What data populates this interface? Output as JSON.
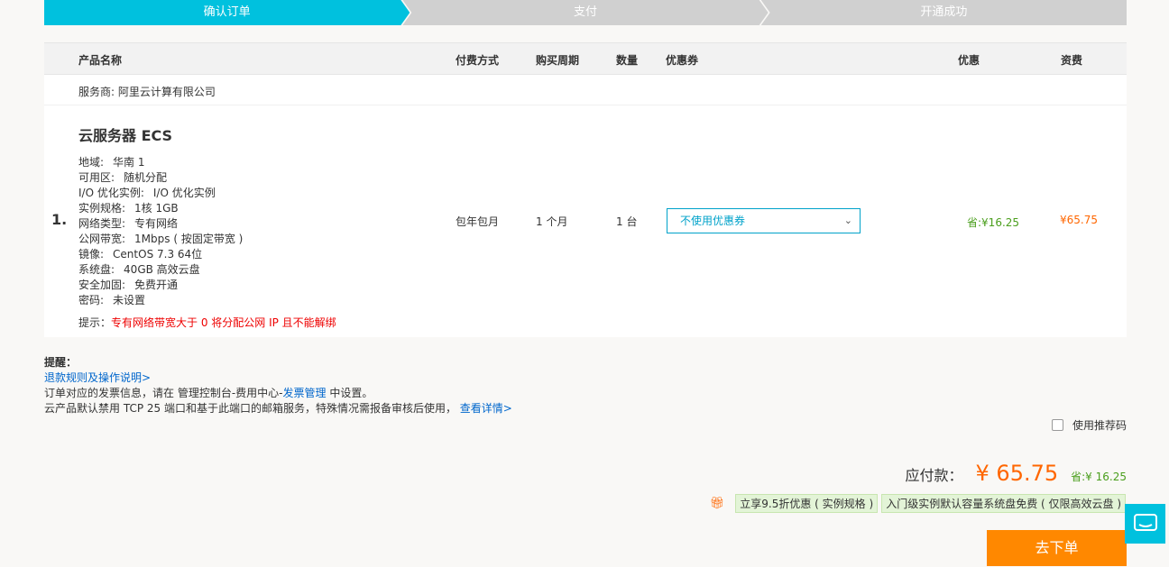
{
  "steps": [
    "确认订单",
    "支付",
    "开通成功"
  ],
  "table": {
    "headers": {
      "product": "产品名称",
      "pay_method": "付费方式",
      "period": "购买周期",
      "quantity": "数量",
      "coupon": "优惠券",
      "discount": "优惠",
      "fee": "资费"
    },
    "provider": "服务商: 阿里云计算有限公司",
    "item": {
      "index": "1.",
      "name": "云服务器 ECS",
      "specs": [
        {
          "label": "地域:",
          "value": "华南 1"
        },
        {
          "label": "可用区:",
          "value": "随机分配"
        },
        {
          "label": "I/O 优化实例:",
          "value": "I/O 优化实例"
        },
        {
          "label": "实例规格:",
          "value": "1核 1GB"
        },
        {
          "label": "网络类型:",
          "value": "专有网络"
        },
        {
          "label": "公网带宽:",
          "value": "1Mbps ( 按固定带宽 )"
        },
        {
          "label": "镜像:",
          "value": "CentOS 7.3 64位"
        },
        {
          "label": "系统盘:",
          "value": "40GB 高效云盘"
        },
        {
          "label": "安全加固:",
          "value": "免费开通"
        },
        {
          "label": "密码:",
          "value": "未设置"
        }
      ],
      "tip_label": "提示：",
      "tip_text": "专有网络带宽大于 0 将分配公网 IP 且不能解绑",
      "pay_method": "包年包月",
      "period": "1 个月",
      "quantity": "1 台",
      "coupon_selected": "不使用优惠券",
      "save": "省:¥16.25",
      "price": "¥65.75"
    }
  },
  "notes": {
    "title": "提醒：",
    "refund_link": "退款规则及操作说明>",
    "invoice_prefix": "订单对应的发票信息，请在 管理控制台-费用中心-",
    "invoice_link": "发票管理",
    "invoice_suffix": " 中设置。",
    "tcp_text": "云产品默认禁用 TCP 25 端口和基于此端口的邮箱服务，特殊情况需报备审核后使用，",
    "tcp_link": "查看详情>"
  },
  "recommend_label": "使用推荐码",
  "total": {
    "label": "应付款：",
    "amount": "¥ 65.75",
    "save": "省:¥ 16.25"
  },
  "promos": [
    "立享9.5折优惠 ( 实例规格 )",
    "入门级实例默认容量系统盘免费 ( 仅限高效云盘 )"
  ],
  "order_button": "去下单",
  "colors": {
    "accent": "#00c1de",
    "price": "#ff6600",
    "save": "#4a9e1c",
    "button": "#ff8800"
  }
}
